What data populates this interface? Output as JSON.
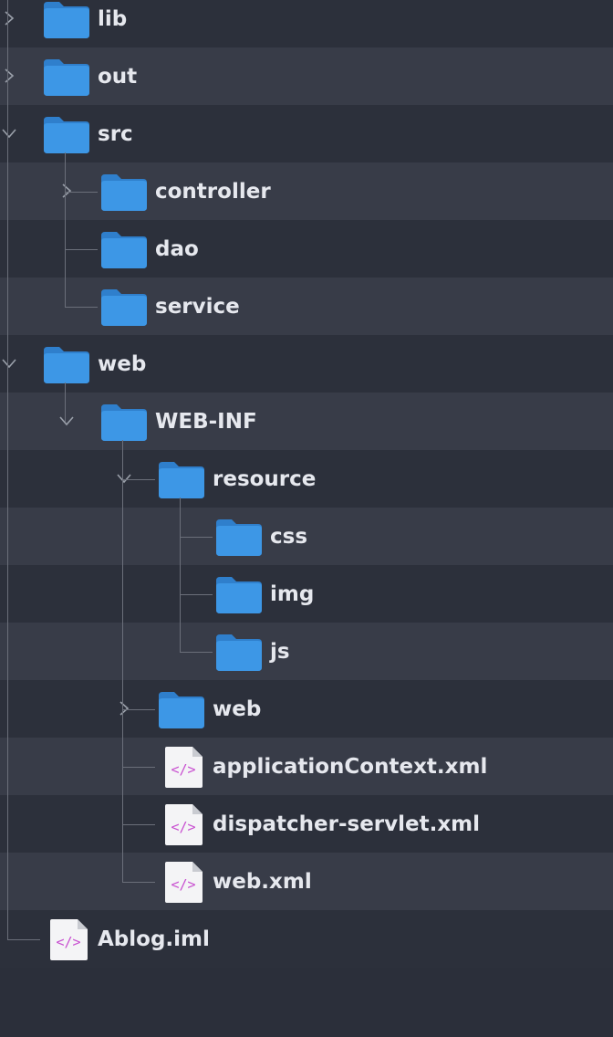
{
  "tree": {
    "items": [
      {
        "label": "lib",
        "icon": "folder-icon",
        "expanded": false
      },
      {
        "label": "out",
        "icon": "folder-icon",
        "expanded": false
      },
      {
        "label": "src",
        "icon": "folder-icon",
        "expanded": true
      },
      {
        "label": "controller",
        "icon": "folder-icon",
        "expanded": false
      },
      {
        "label": "dao",
        "icon": "folder-icon"
      },
      {
        "label": "service",
        "icon": "folder-icon"
      },
      {
        "label": "web",
        "icon": "folder-icon",
        "expanded": true
      },
      {
        "label": "WEB-INF",
        "icon": "folder-icon",
        "expanded": true
      },
      {
        "label": "resource",
        "icon": "folder-icon",
        "expanded": true
      },
      {
        "label": "css",
        "icon": "folder-icon"
      },
      {
        "label": "img",
        "icon": "folder-icon"
      },
      {
        "label": "js",
        "icon": "folder-icon"
      },
      {
        "label": "web",
        "icon": "folder-icon",
        "expanded": false
      },
      {
        "label": "applicationContext.xml",
        "icon": "xml-file-icon"
      },
      {
        "label": "dispatcher-servlet.xml",
        "icon": "xml-file-icon"
      },
      {
        "label": "web.xml",
        "icon": "xml-file-icon"
      },
      {
        "label": "Ablog.iml",
        "icon": "xml-file-icon"
      }
    ]
  },
  "colors": {
    "background": "#2b2f3a",
    "row_alt": "#383c48",
    "folder_blue": "#3d97e6",
    "file_tag": "#c84fd0",
    "guide_line": "#6b6f7a",
    "text": "#e6e8ee"
  }
}
